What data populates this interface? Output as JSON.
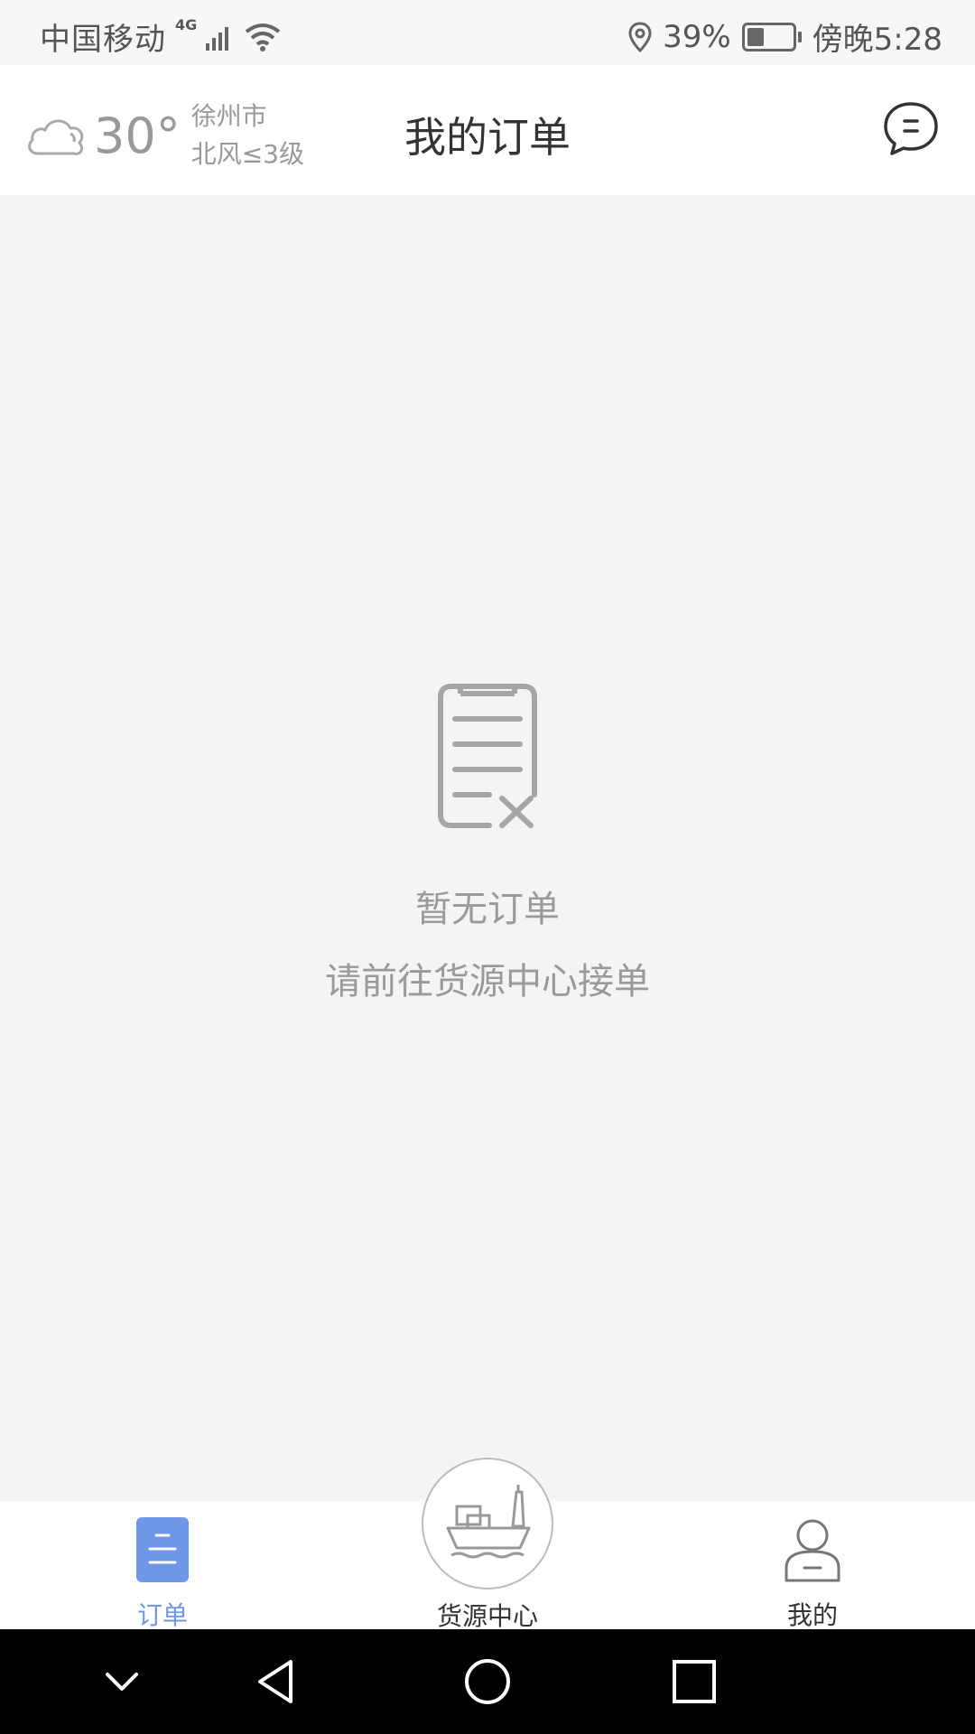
{
  "status_bar": {
    "carrier": "中国移动",
    "network": "4G",
    "battery": "39%",
    "battery_level": 0.39,
    "time": "傍晚5:28"
  },
  "header": {
    "temperature": "30°",
    "city": "徐州市",
    "wind": "北风≤3级",
    "title": "我的订单",
    "icons": {
      "weather": "cloud-icon",
      "message": "chat-bubble-icon"
    }
  },
  "empty_state": {
    "title": "暂无订单",
    "subtitle": "请前往货源中心接单",
    "icon": "clipboard-x-icon"
  },
  "tabs": [
    {
      "label": "订单",
      "icon": "orders-icon",
      "active": true
    },
    {
      "label": "货源中心",
      "icon": "cargo-ship-icon",
      "active": false
    },
    {
      "label": "我的",
      "icon": "user-icon",
      "active": false
    }
  ],
  "colors": {
    "accent": "#6f97e8",
    "text_gray": "#9a9a9a",
    "background": "#f4f4f4"
  }
}
